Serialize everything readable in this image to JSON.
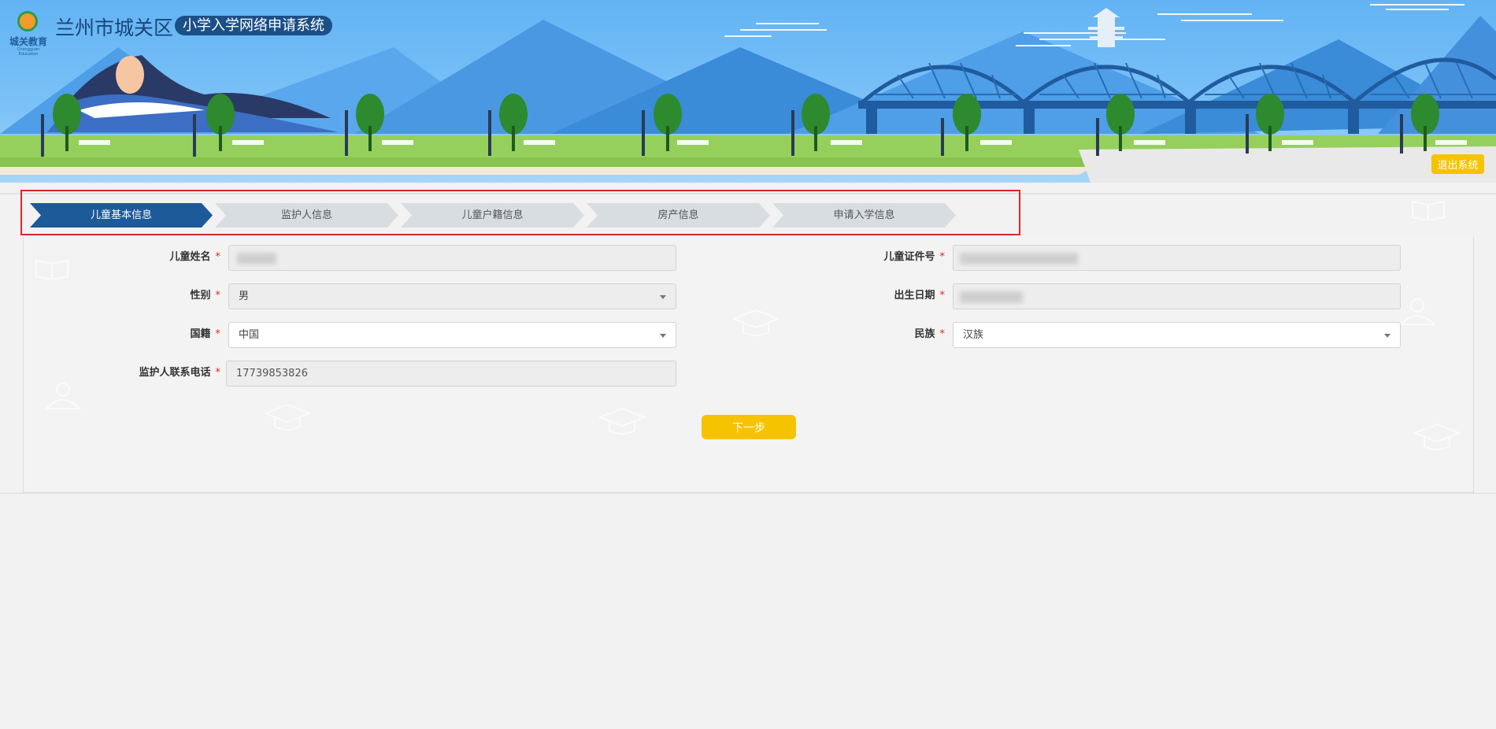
{
  "header": {
    "logo_text": "城关教育",
    "logo_sub": "Chengguan Education",
    "district": "兰州市城关区",
    "system_name": "小学入学网络申请系统",
    "logout_label": "退出系统"
  },
  "steps": [
    {
      "label": "儿童基本信息",
      "active": true
    },
    {
      "label": "监护人信息",
      "active": false
    },
    {
      "label": "儿童户籍信息",
      "active": false
    },
    {
      "label": "房产信息",
      "active": false
    },
    {
      "label": "申请入学信息",
      "active": false
    }
  ],
  "form": {
    "child_name": {
      "label": "儿童姓名",
      "value": ""
    },
    "gender": {
      "label": "性别",
      "value": "男"
    },
    "nationality": {
      "label": "国籍",
      "value": "中国"
    },
    "guardian_phone": {
      "label": "监护人联系电话",
      "value": "17739853826"
    },
    "child_id": {
      "label": "儿童证件号",
      "value": ""
    },
    "birth_date": {
      "label": "出生日期",
      "value": ""
    },
    "ethnicity": {
      "label": "民族",
      "value": "汉族"
    },
    "required_mark": "*"
  },
  "actions": {
    "next_label": "下一步"
  },
  "colors": {
    "primary": "#1c5a9a",
    "accent": "#f5c300",
    "highlight_border": "#e0242c"
  }
}
